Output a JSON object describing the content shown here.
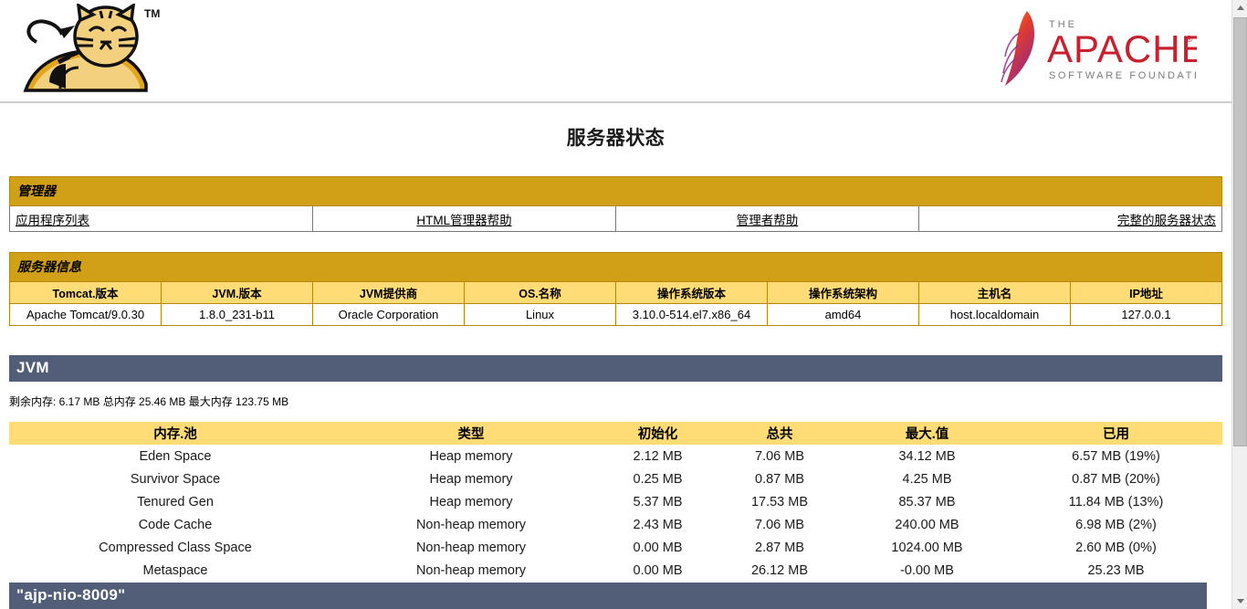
{
  "header": {
    "tomcat_logo_alt": "Apache Tomcat",
    "tomcat_tm": "TM",
    "apache_the": "THE",
    "apache_name": "APACHE",
    "apache_reg": "®",
    "apache_tagline": "SOFTWARE FOUNDATION"
  },
  "page_title": "服务器状态",
  "manager_panel": {
    "title": "管理器",
    "links": [
      {
        "label": "应用程序列表",
        "align": "left"
      },
      {
        "label": "HTML管理器帮助",
        "align": "center"
      },
      {
        "label": "管理者帮助",
        "align": "center"
      },
      {
        "label": "完整的服务器状态",
        "align": "right"
      }
    ]
  },
  "server_info_panel": {
    "title": "服务器信息",
    "headers": [
      "Tomcat.版本",
      "JVM.版本",
      "JVM提供商",
      "OS.名称",
      "操作系统版本",
      "操作系统架构",
      "主机名",
      "IP地址"
    ],
    "values": [
      "Apache Tomcat/9.0.30",
      "1.8.0_231-b11",
      "Oracle Corporation",
      "Linux",
      "3.10.0-514.el7.x86_64",
      "amd64",
      "host.localdomain",
      "127.0.0.1"
    ]
  },
  "jvm_section": {
    "title": "JVM",
    "memory_summary": "剩余内存:  6.17 MB 总内存 25.46 MB 最大内存 123.75 MB",
    "table": {
      "headers": [
        "内存.池",
        "类型",
        "初始化",
        "总共",
        "最大.值",
        "已用"
      ],
      "rows": [
        [
          "Eden Space",
          "Heap memory",
          "2.12 MB",
          "7.06 MB",
          "34.12 MB",
          "6.57 MB (19%)"
        ],
        [
          "Survivor Space",
          "Heap memory",
          "0.25 MB",
          "0.87 MB",
          "4.25 MB",
          "0.87 MB (20%)"
        ],
        [
          "Tenured Gen",
          "Heap memory",
          "5.37 MB",
          "17.53 MB",
          "85.37 MB",
          "11.84 MB (13%)"
        ],
        [
          "Code Cache",
          "Non-heap memory",
          "2.43 MB",
          "7.06 MB",
          "240.00 MB",
          "6.98 MB (2%)"
        ],
        [
          "Compressed Class Space",
          "Non-heap memory",
          "0.00 MB",
          "2.87 MB",
          "1024.00 MB",
          "2.60 MB (0%)"
        ],
        [
          "Metaspace",
          "Non-heap memory",
          "0.00 MB",
          "26.12 MB",
          "-0.00 MB",
          "25.23 MB"
        ]
      ]
    }
  },
  "connector_section": {
    "title": "\"ajp-nio-8009\""
  },
  "colors": {
    "gold_panel_title": "#d2a017",
    "gold_border": "#b8860b",
    "light_gold_header": "#ffdc75",
    "section_bar": "#525d78",
    "apache_red": "#c8202e"
  }
}
